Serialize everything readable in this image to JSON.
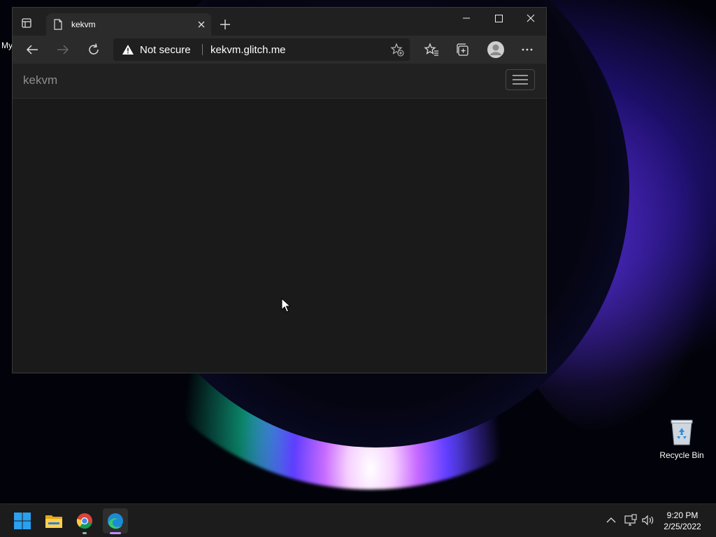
{
  "desktop": {
    "partial_icon_label": "My",
    "recycle_bin_label": "Recycle Bin"
  },
  "browser": {
    "tab_title": "kekvm",
    "security_text": "Not secure",
    "url": "kekvm.glitch.me",
    "site": {
      "brand": "kekvm"
    }
  },
  "taskbar": {
    "apps": [
      "start-icon",
      "file-explorer-icon",
      "chrome-icon",
      "edge-icon"
    ],
    "time": "9:20 PM",
    "date": "2/25/2022"
  },
  "colors": {
    "accent_edge": "#c48dff",
    "windows_blue": "#2aa0f0"
  }
}
